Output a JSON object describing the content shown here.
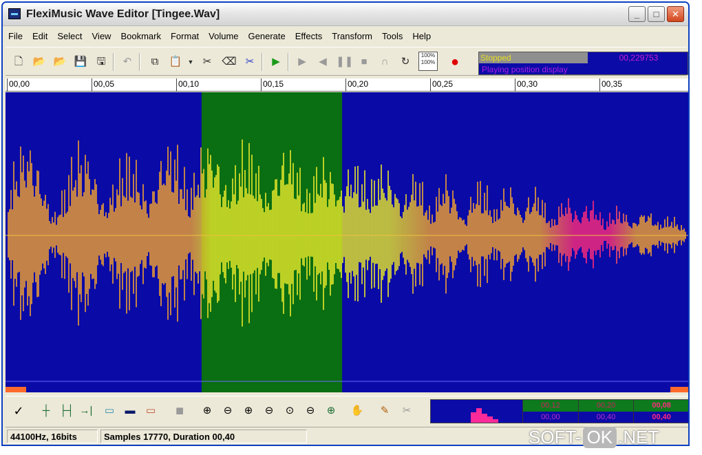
{
  "window": {
    "title": "FlexiMusic Wave Editor [Tingee.Wav]"
  },
  "menu": [
    "File",
    "Edit",
    "Select",
    "View",
    "Bookmark",
    "Format",
    "Volume",
    "Generate",
    "Effects",
    "Transform",
    "Tools",
    "Help"
  ],
  "toolbar": {
    "zoom_label": "100%\n100%",
    "status_mode": "Stopped",
    "status_time": "00,229753",
    "status_position": "Playing position display"
  },
  "ruler": {
    "ticks": [
      "00,00",
      "00,05",
      "00,10",
      "00,15",
      "00,20",
      "00,25",
      "00,30",
      "00,35"
    ]
  },
  "waveform": {
    "duration": 0.4,
    "selection": {
      "start": 0.115,
      "end": 0.198
    },
    "colors": {
      "background": "#0a0aa6",
      "selection": "#0a6e12",
      "wave_orange": "#f0a030",
      "wave_yellow": "#e8e82a",
      "wave_pink": "#ff2a7a"
    }
  },
  "mini_panel": {
    "cells_top": [
      "00,12",
      "00,20",
      "00,08"
    ],
    "cells_bottom": [
      "00,00",
      "00,40",
      "00,40"
    ]
  },
  "statusbar": {
    "format": "44100Hz, 16bits",
    "samples": "Samples 17770, Duration 00,40"
  },
  "watermark": {
    "left": "SOFT-",
    "box": "OK",
    "right": ".NET"
  }
}
